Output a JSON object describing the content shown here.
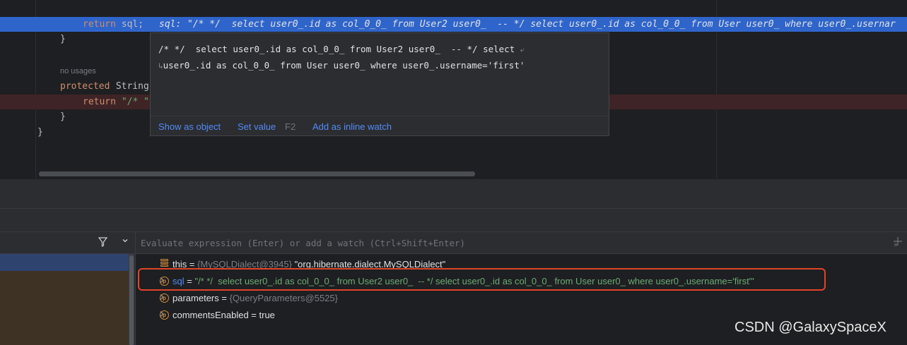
{
  "editor": {
    "return_kw": "return",
    "return_expr": " sql;",
    "inline_label": "sql: ",
    "inline_value": "\"/* */  select user0_.id as col_0_0_ from User2 user0_  -- */ select user0_.id as col_0_0_ from User user0_ where user0_.usernar",
    "brace1": "}",
    "no_usages": "no usages",
    "protected_kw": "protected",
    "protected_rest": " String",
    "return2_kw": "return",
    "return2_str": " \"/* \"",
    "brace2": "}",
    "brace3": "}"
  },
  "popup": {
    "line1": "/* */  select user0_.id as col_0_0_ from User2 user0_  -- */ select ",
    "wrap_mark": "⤶",
    "wrap_start": "↳",
    "line2": "user0_.id as col_0_0_ from User user0_ where user0_.username='first'",
    "show_as_object": "Show as object",
    "set_value": "Set value",
    "set_value_key": "F2",
    "add_inline_watch": "Add as inline watch"
  },
  "debugger": {
    "eval_placeholder": "Evaluate expression (Enter) or add a watch (Ctrl+Shift+Enter)",
    "variables": [
      {
        "name": "this",
        "eq": " = ",
        "ref": "{MySQLDialect@3945}",
        "value": " \"org.hibernate.dialect.MySQLDialect\"",
        "icon": "field-stack-icon",
        "expandable": true
      },
      {
        "name": "sql",
        "eq": " = ",
        "ref": "",
        "value": "\"/* */  select user0_.id as col_0_0_ from User2 user0_  -- */ select user0_.id as col_0_0_ from User user0_ where user0_.username='first'\"",
        "icon": "parameter-icon",
        "expandable": true
      },
      {
        "name": "parameters",
        "eq": " = ",
        "ref": "{QueryParameters@5525}",
        "value": "",
        "icon": "parameter-icon",
        "expandable": true
      },
      {
        "name": "commentsEnabled",
        "eq": " = ",
        "ref": "",
        "value": "true",
        "icon": "parameter-icon",
        "expandable": false
      }
    ]
  },
  "watermark": "CSDN @GalaxySpaceX",
  "colors": {
    "highlight_blue": "#2f65ca",
    "breakpoint_red": "#3e2426",
    "annotation_box": "#e0442a",
    "string_green": "#6aab73",
    "link_blue": "#548af7"
  }
}
